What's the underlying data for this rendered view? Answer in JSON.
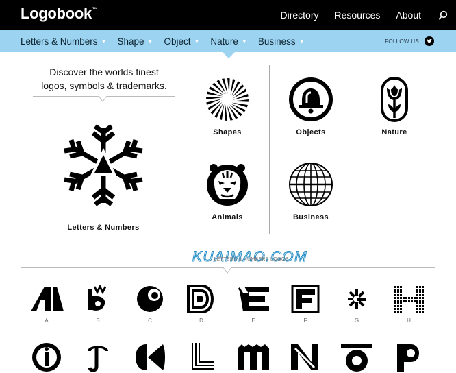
{
  "header": {
    "brand": "Logobook",
    "trademark": "™",
    "nav": [
      "Directory",
      "Resources",
      "About"
    ],
    "search_icon": "search-icon"
  },
  "categories": {
    "items": [
      "Letters & Numbers",
      "Shape",
      "Object",
      "Nature",
      "Business"
    ],
    "follow_label": "FOLLOW US",
    "follow_icon": "twitter-icon"
  },
  "intro": {
    "line1": "Discover the worlds finest",
    "line2": "logos, symbols & trademarks."
  },
  "featured": {
    "label": "Letters & Numbers",
    "icon": "snowflake-a-logo-icon"
  },
  "grid": [
    {
      "label": "Shapes",
      "icon": "sunburst-logo-icon"
    },
    {
      "label": "Objects",
      "icon": "bell-logo-icon"
    },
    {
      "label": "Nature",
      "icon": "tulip-logo-icon"
    },
    {
      "label": "Animals",
      "icon": "tiger-logo-icon"
    },
    {
      "label": "Business",
      "icon": "globe-logo-icon"
    }
  ],
  "section": {
    "watermark": "KUAIMAO.COM",
    "title": "LETTERS & NUMBERS LOGOS"
  },
  "letters_row1": [
    "A",
    "B",
    "C",
    "D",
    "E",
    "F",
    "G",
    "H"
  ],
  "colors": {
    "topbar": "#000000",
    "catbar": "#9bd3f0",
    "accent_text": "#0c2330"
  }
}
